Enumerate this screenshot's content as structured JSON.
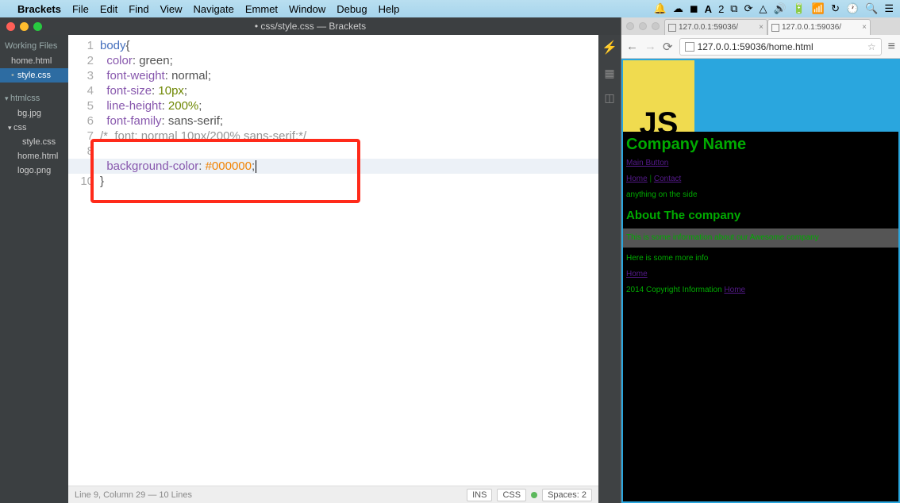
{
  "menubar": {
    "app": "Brackets",
    "items": [
      "File",
      "Edit",
      "Find",
      "View",
      "Navigate",
      "Emmet",
      "Window",
      "Debug",
      "Help"
    ]
  },
  "brackets": {
    "title": "• css/style.css — Brackets",
    "sidebar": {
      "working_label": "Working Files",
      "working": [
        {
          "name": "home.html",
          "active": false
        },
        {
          "name": "style.css",
          "active": true
        }
      ],
      "tree_label": "htmlcss",
      "tree": [
        {
          "name": "bg.jpg",
          "indent": 1
        },
        {
          "name": "css",
          "indent": 0,
          "folder": true
        },
        {
          "name": "style.css",
          "indent": 2
        },
        {
          "name": "home.html",
          "indent": 1
        },
        {
          "name": "logo.png",
          "indent": 1
        }
      ]
    },
    "code": {
      "lines": [
        {
          "n": "1",
          "html": "<span class='tok-sel'>body</span>{"
        },
        {
          "n": "2",
          "html": "  <span class='tok-prop'>color</span>: <span class='tok-val'>green</span>;"
        },
        {
          "n": "3",
          "html": "  <span class='tok-prop'>font-weight</span>: <span class='tok-val'>normal</span>;"
        },
        {
          "n": "4",
          "html": "  <span class='tok-prop'>font-size</span>: <span class='tok-num'>10px</span>;"
        },
        {
          "n": "5",
          "html": "  <span class='tok-prop'>line-height</span>: <span class='tok-num'>200%</span>;"
        },
        {
          "n": "6",
          "html": "  <span class='tok-prop'>font-family</span>: <span class='tok-val'>sans-serif</span>;"
        },
        {
          "n": "7",
          "html": "<span class='tok-com'>/*  font: normal 10px/200% sans-serif;*/</span>"
        },
        {
          "n": "8",
          "html": ""
        },
        {
          "n": "9",
          "html": "  <span class='tok-prop'>background-color</span>: <span class='tok-str'>#000000</span>;<span class='cursor-caret'></span>"
        },
        {
          "n": "10",
          "html": "}"
        }
      ],
      "highlight_line_index": 8
    },
    "status": {
      "left": "Line 9, Column 29 — 10 Lines",
      "ins": "INS",
      "lang": "CSS",
      "spaces": "Spaces: 2"
    }
  },
  "browser": {
    "tabs": [
      {
        "label": "127.0.0.1:59036/",
        "active": false
      },
      {
        "label": "127.0.0.1:59036/",
        "active": true
      }
    ],
    "url": "127.0.0.1:59036/home.html",
    "page": {
      "logo_text": "JS",
      "h1": "Company Name",
      "main_button": "Main Button",
      "nav_home": "Home",
      "nav_sep": " | ",
      "nav_contact": "Contact",
      "side_text": "anything on the side",
      "h2": "About The company",
      "gray_text": "This is some information about our Awesome company",
      "more_info": "Here is some more info",
      "link_home": "Home",
      "footer_pre": "2014 Copyright Information ",
      "footer_link": "Home"
    }
  }
}
